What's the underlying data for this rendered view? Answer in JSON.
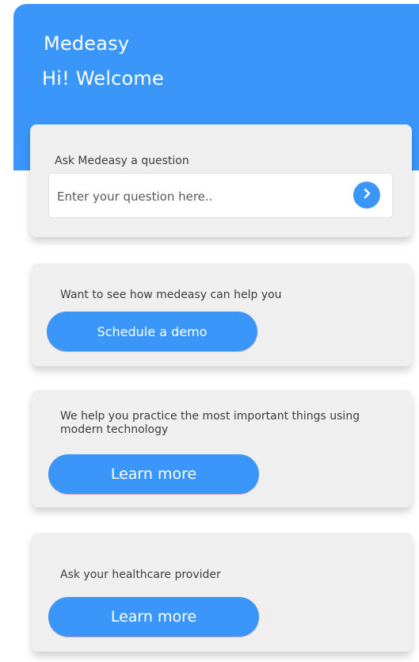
{
  "header": {
    "app_title": "Medeasy",
    "welcome": "Hi! Welcome"
  },
  "ask": {
    "label": "Ask Medeasy a question",
    "input_value": "",
    "placeholder": "Enter your question here.."
  },
  "demo": {
    "label": "Want to see how medeasy can help you",
    "button": "Schedule a demo"
  },
  "learn": {
    "label": "We help you practice the most important things using modern technology",
    "button": "Learn more"
  },
  "provider": {
    "label": "Ask your healthcare provider",
    "button": "Learn more"
  },
  "colors": {
    "accent": "#3a97f9",
    "card": "#efefef"
  },
  "icons": {
    "send": "chevron-right-icon"
  }
}
